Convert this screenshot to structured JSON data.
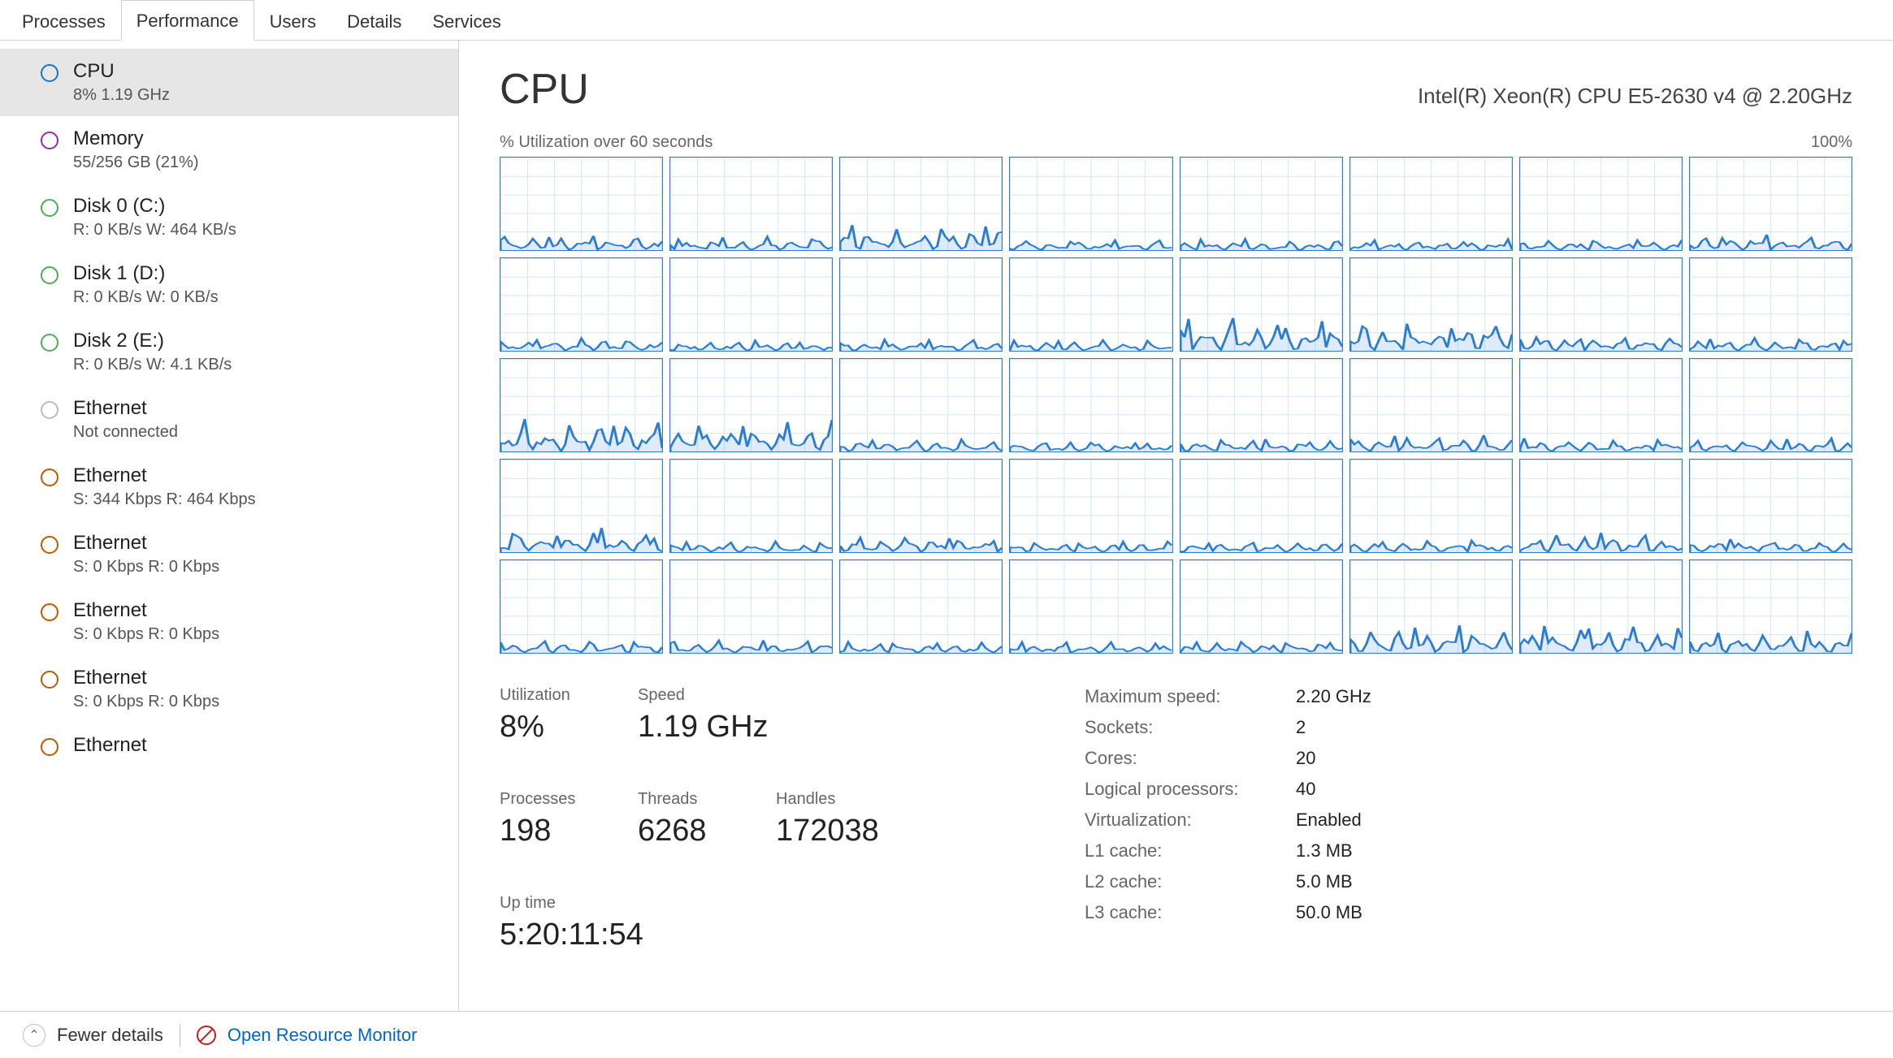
{
  "tabs": [
    "Processes",
    "Performance",
    "Users",
    "Details",
    "Services"
  ],
  "active_tab": 1,
  "sidebar": [
    {
      "icon": "blue",
      "title": "CPU",
      "sub": "8%  1.19 GHz",
      "selected": true
    },
    {
      "icon": "purple",
      "title": "Memory",
      "sub": "55/256 GB (21%)"
    },
    {
      "icon": "green",
      "title": "Disk 0 (C:)",
      "sub": "R: 0 KB/s W: 464 KB/s"
    },
    {
      "icon": "green",
      "title": "Disk 1 (D:)",
      "sub": "R: 0 KB/s W: 0 KB/s"
    },
    {
      "icon": "green",
      "title": "Disk 2 (E:)",
      "sub": "R: 0 KB/s W: 4.1 KB/s"
    },
    {
      "icon": "grey",
      "title": "Ethernet",
      "sub": "Not connected"
    },
    {
      "icon": "orange",
      "title": "Ethernet",
      "sub": "S: 344 Kbps R: 464 Kbps"
    },
    {
      "icon": "orange",
      "title": "Ethernet",
      "sub": "S: 0 Kbps R: 0 Kbps"
    },
    {
      "icon": "orange",
      "title": "Ethernet",
      "sub": "S: 0 Kbps R: 0 Kbps"
    },
    {
      "icon": "orange",
      "title": "Ethernet",
      "sub": "S: 0 Kbps R: 0 Kbps"
    },
    {
      "icon": "orange",
      "title": "Ethernet",
      "sub": ""
    }
  ],
  "header": {
    "title": "CPU",
    "model": "Intel(R) Xeon(R) CPU E5-2630 v4 @ 2.20GHz"
  },
  "chart_label_left": "% Utilization over 60 seconds",
  "chart_label_right": "100%",
  "stats_left": [
    {
      "label": "Utilization",
      "value": "8%"
    },
    {
      "label": "Speed",
      "value": "1.19 GHz"
    },
    {
      "label": "Processes",
      "value": "198"
    },
    {
      "label": "Threads",
      "value": "6268"
    },
    {
      "label": "Handles",
      "value": "172038"
    },
    {
      "label": "Up time",
      "value": "5:20:11:54"
    }
  ],
  "stats_right": [
    {
      "label": "Maximum speed:",
      "value": "2.20 GHz"
    },
    {
      "label": "Sockets:",
      "value": "2"
    },
    {
      "label": "Cores:",
      "value": "20"
    },
    {
      "label": "Logical processors:",
      "value": "40"
    },
    {
      "label": "Virtualization:",
      "value": "Enabled"
    },
    {
      "label": "L1 cache:",
      "value": "1.3 MB"
    },
    {
      "label": "L2 cache:",
      "value": "5.0 MB"
    },
    {
      "label": "L3 cache:",
      "value": "50.0 MB"
    }
  ],
  "footer": {
    "fewer": "Fewer details",
    "open_rm": "Open Resource Monitor"
  },
  "chart_data": {
    "type": "line",
    "title": "% Utilization over 60 seconds",
    "ylim": [
      0,
      100
    ],
    "xlabel": "seconds",
    "ylabel": "% Utilization",
    "num_cores": 40,
    "note": "Each of 40 logical processors shows low utilization (~5-15%) with intermittent small spikes up to ~30-40%. Cores 12 and 13 (row 2, cols 5-6) show sustained ~25-30% activity.",
    "series_approx_peak_pct": [
      15,
      12,
      25,
      10,
      10,
      10,
      10,
      15,
      12,
      10,
      10,
      10,
      30,
      30,
      15,
      12,
      30,
      30,
      12,
      10,
      12,
      15,
      12,
      12,
      22,
      10,
      15,
      10,
      10,
      12,
      18,
      12,
      12,
      12,
      10,
      10,
      12,
      25,
      25,
      20
    ]
  }
}
